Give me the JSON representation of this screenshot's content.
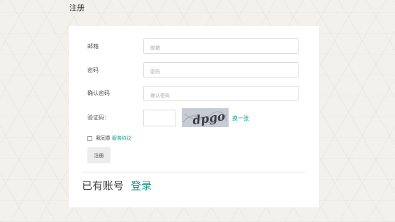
{
  "header": {
    "title": "注册"
  },
  "form": {
    "email": {
      "label": "邮箱",
      "placeholder": "邮箱",
      "value": ""
    },
    "password": {
      "label": "密码",
      "placeholder": "密码",
      "value": ""
    },
    "confirm_password": {
      "label": "确认密码",
      "placeholder": "确认密码",
      "value": ""
    },
    "captcha": {
      "label": "验证码：",
      "value": "",
      "image_text": "dpgo",
      "refresh_label": "换一张"
    },
    "agreement": {
      "checked": false,
      "prefix": "我同意",
      "link_label": "服务协议"
    },
    "submit_label": "注册"
  },
  "footer": {
    "have_account_text": "已有账号",
    "login_label": "登录"
  },
  "colors": {
    "accent": "#1e9e8a",
    "background": "#f3f1ec",
    "card": "#ffffff"
  }
}
